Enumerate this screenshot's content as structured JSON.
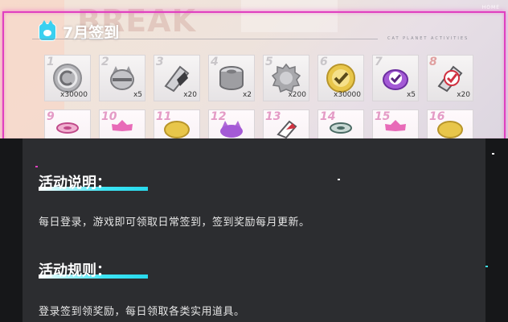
{
  "header": {
    "title": "7月签到",
    "subtitle": "CAT PLANET ACTIVITIES",
    "home_label": "HOME",
    "bg_text": "BREAK",
    "accent_color": "#e040c0"
  },
  "rewards": [
    {
      "day": "1",
      "qty": "x30000",
      "icon": "gray-coin-icon"
    },
    {
      "day": "2",
      "qty": "x5",
      "icon": "gray-cat-capsule-icon"
    },
    {
      "day": "3",
      "qty": "x20",
      "icon": "gray-ticket-icon"
    },
    {
      "day": "4",
      "qty": "x2",
      "icon": "gray-can-icon"
    },
    {
      "day": "5",
      "qty": "x200",
      "icon": "gray-gear-icon"
    },
    {
      "day": "6",
      "qty": "x30000",
      "icon": "gold-check-coin-icon"
    },
    {
      "day": "7",
      "qty": "x5",
      "icon": "purple-check-capsule-icon"
    },
    {
      "day": "8",
      "qty": "x20",
      "icon": "ticket-check-icon"
    },
    {
      "day": "9",
      "qty": "",
      "icon": "pink-can-icon"
    },
    {
      "day": "10",
      "qty": "",
      "icon": "pink-gear-icon"
    },
    {
      "day": "11",
      "qty": "",
      "icon": "gold-coin-icon"
    },
    {
      "day": "12",
      "qty": "",
      "icon": "purple-capsule-icon"
    },
    {
      "day": "13",
      "qty": "",
      "icon": "red-ticket-icon"
    },
    {
      "day": "14",
      "qty": "",
      "icon": "teal-can-icon"
    },
    {
      "day": "15",
      "qty": "",
      "icon": "pink-gear-icon"
    },
    {
      "day": "16",
      "qty": "",
      "icon": "gold-coin-icon"
    }
  ],
  "sections": [
    {
      "heading": "活动说明：",
      "text": "每日登录，游戏即可领取日常签到，签到奖励每月更新。"
    },
    {
      "heading": "活动规则：",
      "text": "登录签到领奖励，每日领取各类实用道具。"
    }
  ]
}
